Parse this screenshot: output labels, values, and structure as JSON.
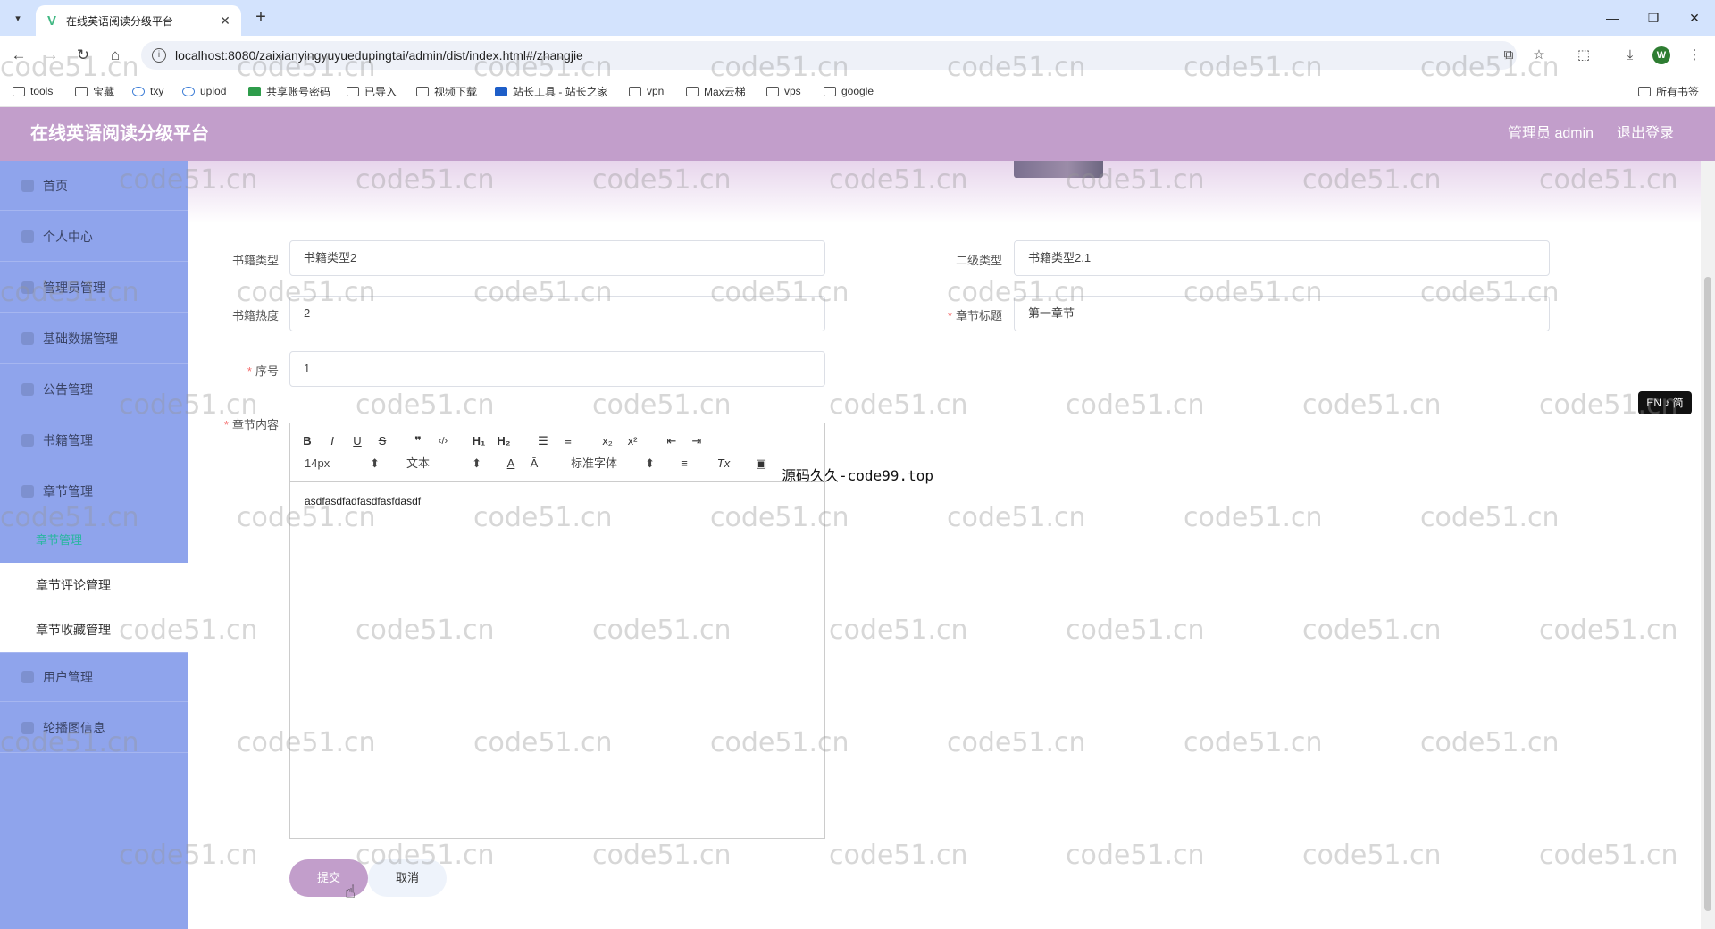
{
  "browser": {
    "tab_title": "在线英语阅读分级平台",
    "url": "localhost:8080/zaixianyingyuyuedupingtai/admin/dist/index.html#/zhangjie",
    "profile_initial": "W",
    "bookmarks": [
      "tools",
      "宝藏",
      "txy",
      "uplod",
      "共享账号密码",
      "已导入",
      "视频下载",
      "站长工具 - 站长之家",
      "vpn",
      "Max云梯",
      "vps",
      "google"
    ],
    "all_bookmarks": "所有书签"
  },
  "header": {
    "title": "在线英语阅读分级平台",
    "user": "管理员 admin",
    "logout": "退出登录"
  },
  "sidebar": {
    "items": [
      "首页",
      "个人中心",
      "管理员管理",
      "基础数据管理",
      "公告管理",
      "书籍管理",
      "章节管理"
    ],
    "active_sub": "章节管理",
    "subitems": [
      "章节评论管理",
      "章节收藏管理"
    ],
    "items_after": [
      "用户管理",
      "轮播图信息"
    ]
  },
  "form": {
    "book_type_label": "书籍类型",
    "book_type_value": "书籍类型2",
    "sub_type_label": "二级类型",
    "sub_type_value": "书籍类型2.1",
    "heat_label": "书籍热度",
    "heat_value": "2",
    "chapter_title_label": "章节标题",
    "chapter_title_value": "第一章节",
    "order_label": "序号",
    "order_value": "1",
    "content_label": "章节内容"
  },
  "editor": {
    "font_size": "14px",
    "block_format": "文本",
    "font_family": "标准字体",
    "content": "asdfasdfadfasdfasfdasdf"
  },
  "buttons": {
    "submit": "提交",
    "cancel": "取消"
  },
  "overlay": {
    "lang_badge": "EN ♪ 简",
    "site_text": "源码久久-code99.top"
  },
  "watermark": "code51.cn",
  "colors": {
    "header": "#c29ecb",
    "sidebar": "#8fa4ec",
    "accent_sub": "#29b6a0"
  }
}
